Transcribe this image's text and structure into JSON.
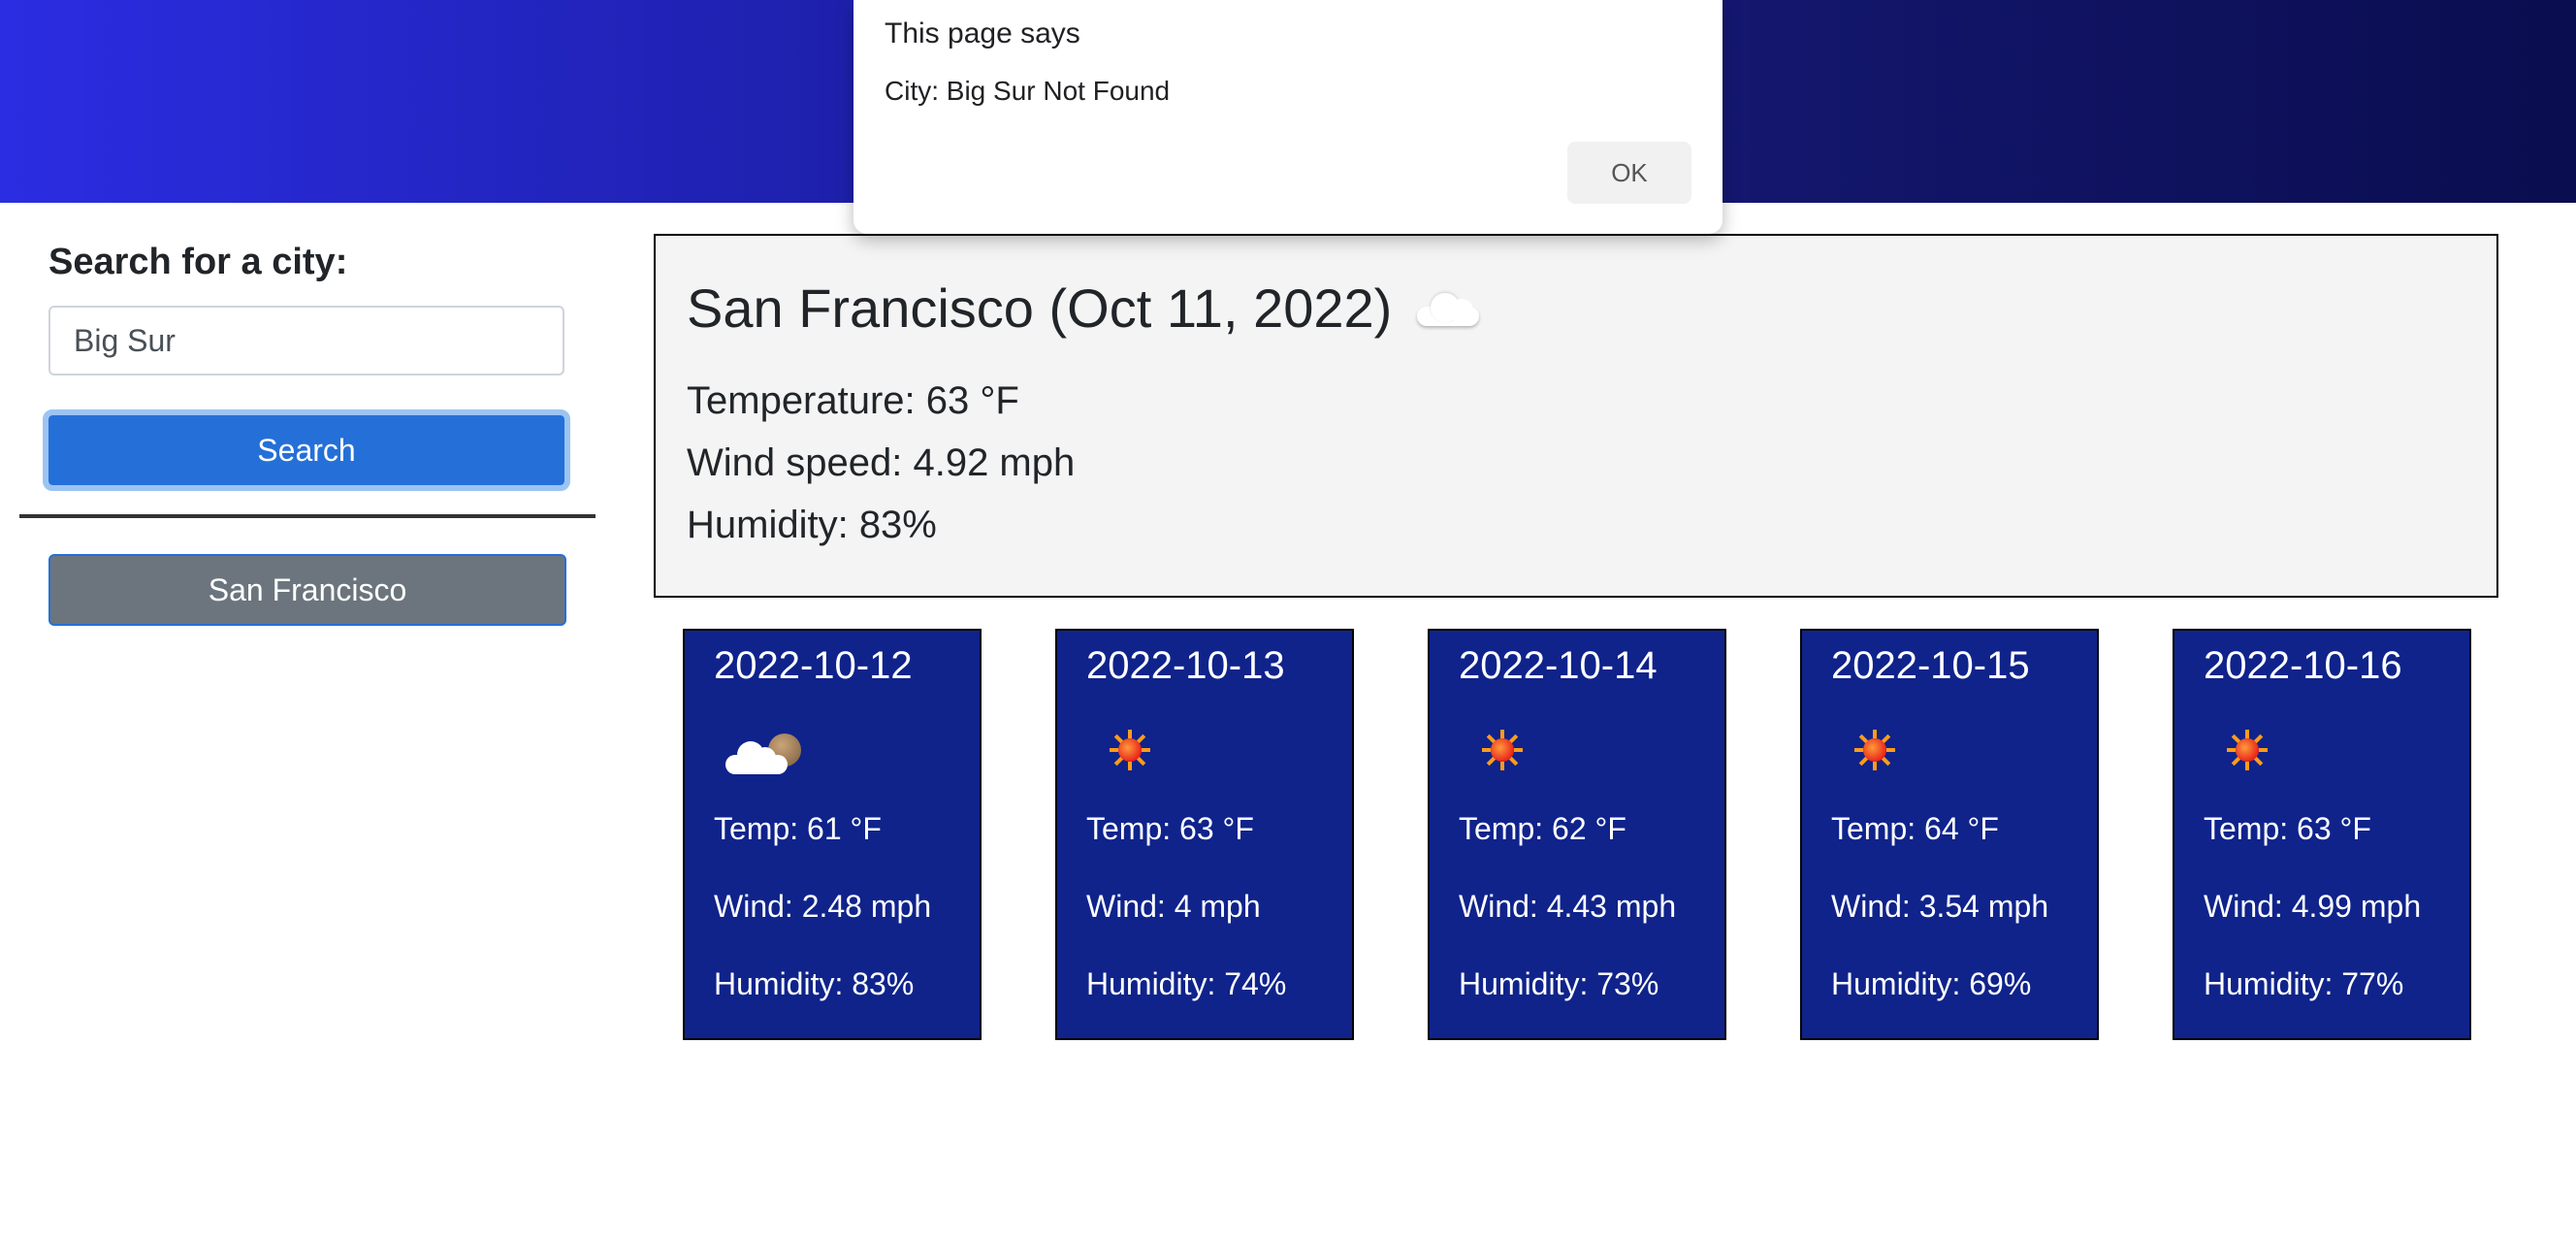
{
  "sidebar": {
    "search_label": "Search for a city:",
    "search_value": "Big Sur",
    "search_button": "Search",
    "history": [
      "San Francisco"
    ]
  },
  "current": {
    "title": "San Francisco (Oct 11, 2022)",
    "icon": "cloud-icon",
    "temperature": "Temperature: 63 °F",
    "wind": "Wind speed: 4.92 mph",
    "humidity": "Humidity: 83%"
  },
  "forecast": [
    {
      "date": "2022-10-12",
      "icon": "partly-cloudy-icon",
      "temp": "Temp: 61 °F",
      "wind": "Wind: 2.48 mph",
      "humidity": "Humidity: 83%"
    },
    {
      "date": "2022-10-13",
      "icon": "sun-icon",
      "temp": "Temp: 63 °F",
      "wind": "Wind: 4 mph",
      "humidity": "Humidity: 74%"
    },
    {
      "date": "2022-10-14",
      "icon": "sun-icon",
      "temp": "Temp: 62 °F",
      "wind": "Wind: 4.43 mph",
      "humidity": "Humidity: 73%"
    },
    {
      "date": "2022-10-15",
      "icon": "sun-icon",
      "temp": "Temp: 64 °F",
      "wind": "Wind: 3.54 mph",
      "humidity": "Humidity: 69%"
    },
    {
      "date": "2022-10-16",
      "icon": "sun-icon",
      "temp": "Temp: 63 °F",
      "wind": "Wind: 4.99 mph",
      "humidity": "Humidity: 77%"
    }
  ],
  "dialog": {
    "title": "This page says",
    "message": "City: Big Sur Not Found",
    "ok_label": "OK"
  },
  "colors": {
    "header_start": "#2b2de2",
    "header_end": "#0a0d4f",
    "search_button": "#2470d8",
    "history_button": "#6c757d",
    "forecast_card": "#0f238b"
  }
}
